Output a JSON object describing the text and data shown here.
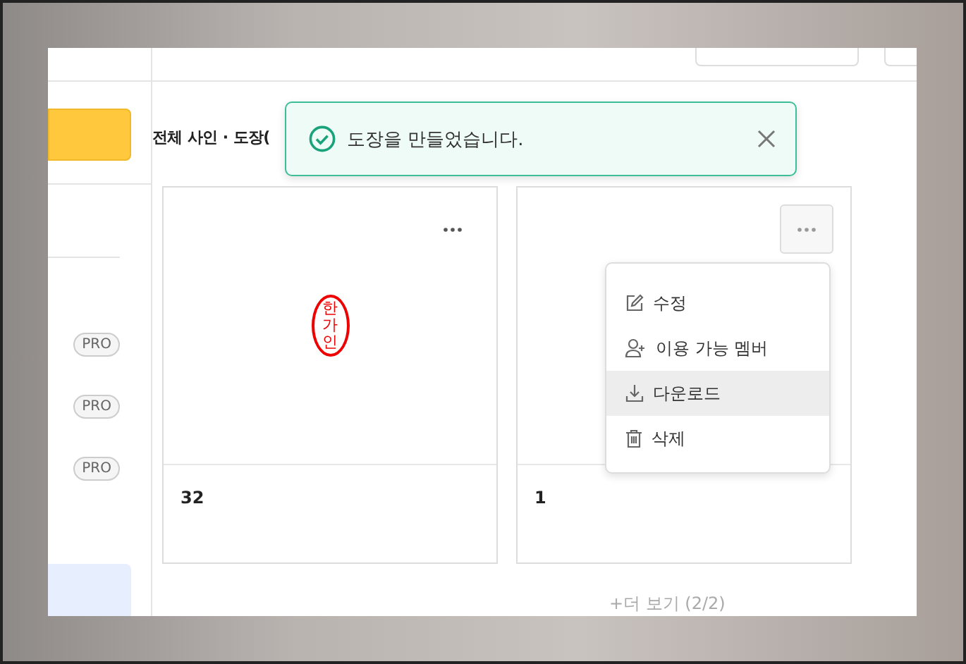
{
  "sidebar": {
    "pro_badges": [
      "PRO",
      "PRO",
      "PRO"
    ]
  },
  "heading": "전체 사인 · 도장(",
  "toast": {
    "message": "도장을 만들었습니다."
  },
  "cards": [
    {
      "stamp_text": "한가인",
      "name": "32",
      "menu_open": false
    },
    {
      "name": "1",
      "menu_open": true
    }
  ],
  "menu": [
    {
      "kind": "edit",
      "label": "수정",
      "selected": false
    },
    {
      "kind": "member",
      "label": "이용 가능 멤버",
      "selected": false
    },
    {
      "kind": "download",
      "label": "다운로드",
      "selected": true
    },
    {
      "kind": "delete",
      "label": "삭제",
      "selected": false
    }
  ],
  "more_link": "+더 보기 (2/2)"
}
